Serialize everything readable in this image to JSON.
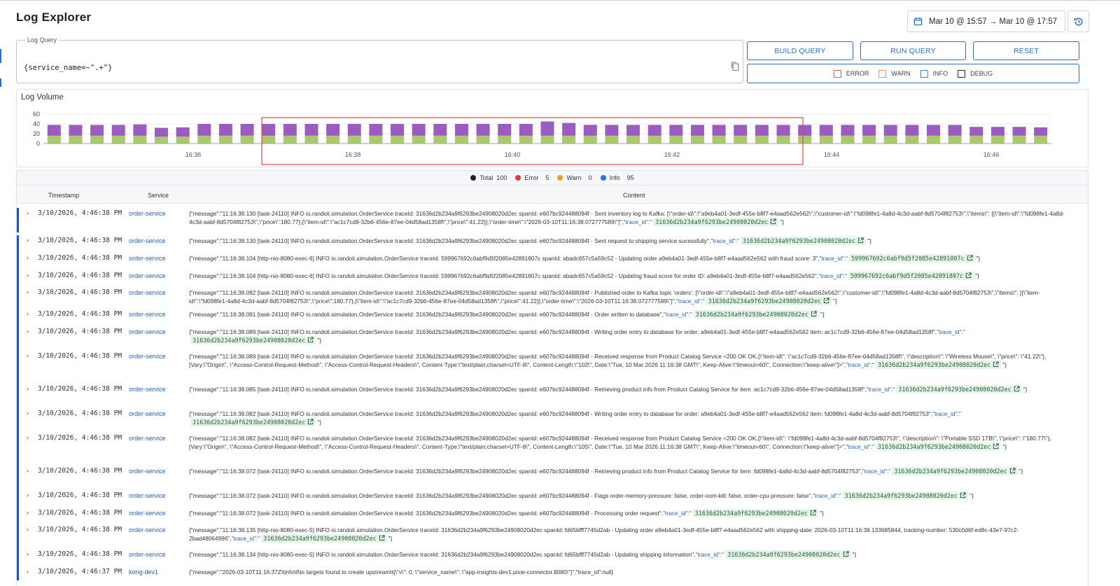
{
  "page": {
    "title": "Log Explorer"
  },
  "date_range": {
    "label": "Mar 10 @ 15:57 → Mar 10 @ 17:57"
  },
  "query": {
    "legend": "Log Query",
    "value": "{service_name=~\".+\"}"
  },
  "buttons": {
    "build": "BUILD QUERY",
    "run": "RUN QUERY",
    "reset": "RESET"
  },
  "levels": [
    {
      "label": "ERROR",
      "color": "#e05a5a"
    },
    {
      "label": "WARN",
      "color": "#e8954a"
    },
    {
      "label": "INFO",
      "color": "#3b7bd6"
    },
    {
      "label": "DEBUG",
      "color": "#222222"
    }
  ],
  "volume": {
    "title": "Log Volume"
  },
  "chart_data": {
    "type": "bar",
    "stacked": true,
    "yticks": [
      "60",
      "40",
      "20",
      "0"
    ],
    "ylim": [
      0,
      60
    ],
    "xticks": [
      "16:36",
      "16:38",
      "16:40",
      "16:42",
      "16:44",
      "16:46"
    ],
    "selection": {
      "from": "16:37:30",
      "to": "16:43:00"
    },
    "series": [
      {
        "color": "#a9c96b",
        "values": [
          16,
          16,
          16,
          16,
          16,
          14,
          14,
          16,
          16,
          16,
          16,
          16,
          16,
          16,
          16,
          16,
          16,
          16,
          16,
          16,
          16,
          16,
          16,
          16,
          16,
          16,
          16,
          16,
          16,
          16,
          16,
          16,
          16,
          16,
          16,
          16,
          16,
          16,
          16,
          16,
          16,
          16,
          16,
          16,
          16,
          16,
          16
        ]
      },
      {
        "color": "#9a5cc0",
        "values": [
          22,
          22,
          22,
          22,
          23,
          18,
          19,
          24,
          24,
          24,
          24,
          24,
          24,
          24,
          24,
          24,
          24,
          24,
          24,
          24,
          24,
          24,
          24,
          29,
          26,
          22,
          22,
          22,
          22,
          22,
          22,
          22,
          22,
          22,
          22,
          22,
          22,
          22,
          22,
          22,
          22,
          22,
          22,
          18,
          18,
          18,
          17
        ]
      }
    ]
  },
  "summary": {
    "total_label": "Total",
    "total": "100",
    "error_label": "Error",
    "error": "5",
    "warn_label": "Warn",
    "warn": "0",
    "info_label": "Info",
    "info": "95"
  },
  "table": {
    "headers": {
      "timestamp": "Timestamp",
      "service": "Service",
      "content": "Content"
    },
    "rows": [
      {
        "ts": "3/10/2026, 4:46:38 PM",
        "service": "order-service",
        "msg": "{\"message\":\"11:16:38.130 [task-24110] INFO  io.randoli.simulation.OrderService traceId: 31636d2b234a9f6293be24908020d2ec spanId: e607bc924488094f - Sent inventory log to Kafka: [\\\"order-id\\\":\\\"a9eb4a01-3edf-455e-b8f7-e4aad562e562\\\",\\\"customer-id\\\":\\\"fd098fe1-4a8d-4c3d-aabf-8d5704f82753\\\",\\\"items\\\": [{\\\"item-id\\\":\\\"fd098fe1-4a8d-4c3d-aabf-8d5704f82753\\\",\\\"price\\\":180.77},{\\\"item-id\\\":\\\"ac1c7cd9-32b6-456e-87ee-04d58ad1358f\\\",\\\"price\\\":41.22}],\\\"order-time\\\":\\\"2026-03-10T11:16:38.072777589\\\"]\",",
        "trace_key": "\"trace_id\":\"",
        "trace": "31636d2b234a9f6293be24908020d2ec",
        "tail": "\"}"
      },
      {
        "ts": "3/10/2026, 4:46:38 PM",
        "service": "order-service",
        "msg": "{\"message\":\"11:16:38.130 [task-24110] INFO  io.randoli.simulation.OrderService traceId: 31636d2b234a9f6293be24908020d2ec spanId: e607bc924488094f - Sent request to shipping service sucessfully\",",
        "trace_key": "\"trace_id\":\"",
        "trace": "31636d2b234a9f6293be24908020d2ec",
        "tail": "\"}"
      },
      {
        "ts": "3/10/2026, 4:46:38 PM",
        "service": "order-service",
        "msg": "{\"message\":\"11:16:38.104 [http-nio-8080-exec-6] INFO  io.randoli.simulation.OrderService traceId: 599967692c6abf9d5f2085e42891807c spanId: abadc657c5a59c52 - Updating order a9eb4a01-3edf-455e-b8f7-e4aad562e562 with fraud score: 3\",",
        "trace_key": "\"trace_id\":\"",
        "trace": "599967692c6abf9d5f2085e42891807c",
        "tail": "\"}"
      },
      {
        "ts": "3/10/2026, 4:46:38 PM",
        "service": "order-service",
        "msg": "{\"message\":\"11:16:38.104 [http-nio-8080-exec-6] INFO  io.randoli.simulation.OrderService traceId: 599967692c6abf9d5f2085e42891807c spanId: abadc657c5a59c52 - Updating fraud score for order ID: a9eb4a01-3edf-455e-b8f7-e4aad562e562\",",
        "trace_key": "\"trace_id\":\"",
        "trace": "599967692c6abf9d5f2085e42891807c",
        "tail": "\"}"
      },
      {
        "ts": "3/10/2026, 4:46:38 PM",
        "service": "order-service",
        "msg": "{\"message\":\"11:16:38.092 [task-24110] INFO  io.randoli.simulation.OrderService traceId: 31636d2b234a9f6293be24908020d2ec spanId: e607bc924488094f - Published order to Kafka topic 'orders': [\\\"order-id\\\":\\\"a9eb4a01-3edf-455e-b8f7-e4aad562e562\\\",\\\"customer-id\\\":\\\"fd098fe1-4a8d-4c3d-aabf-8d5704f82753\\\",\\\"items\\\": [{\\\"item-id\\\":\\\"fd098fe1-4a8d-4c3d-aabf-8d5704f82753\\\",\\\"price\\\":180.77},{\\\"item-id\\\":\\\"ac1c7cd9-32b6-456e-87ee-04d58ad1358f\\\",\\\"price\\\":41.22}],\\\"order-time\\\":\\\"2026-03-10T11:16:38.072777589\\\"]\",",
        "trace_key": "\"trace_id\":\"",
        "trace": "31636d2b234a9f6293be24908020d2ec",
        "tail": "\"}"
      },
      {
        "ts": "3/10/2026, 4:46:38 PM",
        "service": "order-service",
        "msg": "{\"message\":\"11:16:38.091 [task-24110] INFO  io.randoli.simulation.OrderService traceId: 31636d2b234a9f6293be24908020d2ec spanId: e607bc924488094f - Order written to database\",",
        "trace_key": "\"trace_id\":\"",
        "trace": "31636d2b234a9f6293be24908020d2ec",
        "tail": "\"}"
      },
      {
        "ts": "3/10/2026, 4:46:38 PM",
        "service": "order-service",
        "msg": "{\"message\":\"11:16:38.089 [task-24110] INFO  io.randoli.simulation.OrderService traceId: 31636d2b234a9f6293be24908020d2ec spanId: e607bc924488094f - Writing order entry to database for order: a9eb4a01-3edf-455e-b8f7-e4aad562e562 item: ac1c7cd9-32b6-456e-87ee-04d58ad1358f\",",
        "trace_key": "\"trace_id\":\"",
        "trace": "31636d2b234a9f6293be24908020d2ec",
        "tail": "\"}"
      },
      {
        "ts": "3/10/2026, 4:46:38 PM",
        "service": "order-service",
        "msg": "{\"message\":\"11:16:38.089 [task-24110] INFO  io.randoli.simulation.OrderService traceId: 31636d2b234a9f6293be24908020d2ec spanId: e607bc924488094f - Received response from Product Catalog Service <200 OK OK,{\\\"item-id\\\": \\\"ac1c7cd9-32b6-456e-87ee-04d58ad1358f\\\", \\\"description\\\": \\\"Wireless Mouse\\\", \\\"price\\\": \\\"41.22\\\"},[Vary:\\\"Origin\\\", \\\"Access-Control-Request-Method\\\", \\\"Access-Control-Request-Headers\\\", Content-Type:\\\"text/plain;charset=UTF-8\\\", Content-Length:\\\"102\\\", Date:\\\"Tue, 10 Mar 2026 11:16:38 GMT\\\", Keep-Alive:\\\"timeout=60\\\", Connection:\\\"keep-alive\\\"]>\",",
        "trace_key": "\"trace_id\":\"",
        "trace": "31636d2b234a9f6293be24908020d2ec",
        "tail": "\"}"
      },
      {
        "ts": "3/10/2026, 4:46:38 PM",
        "service": "order-service",
        "msg": "{\"message\":\"11:16:38.085 [task-24110] INFO  io.randoli.simulation.OrderService traceId: 31636d2b234a9f6293be24908020d2ec spanId: e607bc924488094f - Retrieving product info from Product Catalog Service for item :ac1c7cd9-32b6-456e-87ee-04d58ad1358f\",",
        "trace_key": "\"trace_id\":\"",
        "trace": "31636d2b234a9f6293be24908020d2ec",
        "tail": "\"}"
      },
      {
        "ts": "3/10/2026, 4:46:38 PM",
        "service": "order-service",
        "msg": "{\"message\":\"11:16:38.082 [task-24110] INFO  io.randoli.simulation.OrderService traceId: 31636d2b234a9f6293be24908020d2ec spanId: e607bc924488094f - Writing order entry to database for order: a9eb4a01-3edf-455e-b8f7-e4aad562e562 item: fd098fe1-4a8d-4c3d-aabf-8d5704f82753\",",
        "trace_key": "\"trace_id\":\"",
        "trace": "31636d2b234a9f6293be24908020d2ec",
        "tail": "\"}"
      },
      {
        "ts": "3/10/2026, 4:46:38 PM",
        "service": "order-service",
        "msg": "{\"message\":\"11:16:38.082 [task-24110] INFO  io.randoli.simulation.OrderService traceId: 31636d2b234a9f6293be24908020d2ec spanId: e607bc924488094f - Received response from Product Catalog Service <200 OK OK,{\\\"item-id\\\": \\\"fd098fe1-4a8d-4c3d-aabf-8d5704f82753\\\", \\\"description\\\": \\\"Portable SSD 1TB\\\", \\\"price\\\": \\\"180.77\\\"},[Vary:\\\"Origin\\\", \\\"Access-Control-Request-Method\\\", \\\"Access-Control-Request-Headers\\\", Content-Type:\\\"text/plain;charset=UTF-8\\\", Content-Length:\\\"105\\\", Date:\\\"Tue, 10 Mar 2026 11:16:38 GMT\\\", Keep-Alive:\\\"timeout=60\\\", Connection:\\\"keep-alive\\\"]>\",",
        "trace_key": "\"trace_id\":\"",
        "trace": "31636d2b234a9f6293be24908020d2ec",
        "tail": "\"}"
      },
      {
        "ts": "3/10/2026, 4:46:38 PM",
        "service": "order-service",
        "msg": "{\"message\":\"11:16:38.072 [task-24110] INFO  io.randoli.simulation.OrderService traceId: 31636d2b234a9f6293be24908020d2ec spanId: e607bc924488094f - Retrieving product info from Product Catalog Service for item :fd098fe1-4a8d-4c3d-aabf-8d5704f82753\",",
        "trace_key": "\"trace_id\":\"",
        "trace": "31636d2b234a9f6293be24908020d2ec",
        "tail": "\"}"
      },
      {
        "ts": "3/10/2026, 4:46:38 PM",
        "service": "order-service",
        "msg": "{\"message\":\"11:16:38.072 [task-24110] INFO  io.randoli.simulation.OrderService traceId: 31636d2b234a9f6293be24908020d2ec spanId: e607bc924488094f - Flags order-memory-pressure: false, order-oom-kill: false, order-cpu-pressure: false\",",
        "trace_key": "\"trace_id\":\"",
        "trace": "31636d2b234a9f6293be24908020d2ec",
        "tail": "\"}"
      },
      {
        "ts": "3/10/2026, 4:46:38 PM",
        "service": "order-service",
        "msg": "{\"message\":\"11:16:38.072 [task-24110] INFO  io.randoli.simulation.OrderService traceId: 31636d2b234a9f6293be24908020d2ec spanId: e607bc924488094f - Processing order request\",",
        "trace_key": "\"trace_id\":\"",
        "trace": "31636d2b234a9f6293be24908020d2ec",
        "tail": "\"}"
      },
      {
        "ts": "3/10/2026, 4:46:38 PM",
        "service": "order-service",
        "msg": "{\"message\":\"11:16:38.135 [http-nio-8080-exec-5] INFO  io.randoli.simulation.OrderService traceId: 31636d2b234a9f6293be24908020d2ec spanId: fd65bfff7745d2ab - Updating order a9eb4a01-3edf-455e-b8f7-e4aad562e562 with shipping-date: 2026-03-10T11:16:38.133685844, tracking-number: 530c0d6f-ed8c-43e7-97c2-2bad48064996\",",
        "trace_key": "\"trace_id\":\"",
        "trace": "31636d2b234a9f6293be24908020d2ec",
        "tail": "\"}"
      },
      {
        "ts": "3/10/2026, 4:46:38 PM",
        "service": "order-service",
        "msg": "{\"message\":\"11:16:38.134 [http-nio-8080-exec-5] INFO  io.randoli.simulation.OrderService traceId: 31636d2b234a9f6293be24908020d2ec spanId: fd65bfff7745d2ab - Updating shipping information\",",
        "trace_key": "\"trace_id\":\"",
        "trace": "31636d2b234a9f6293be24908020d2ec",
        "tail": "\"}"
      },
      {
        "ts": "3/10/2026, 4:46:37 PM",
        "service": "kong-dev1",
        "msg": "{\"message\":\"2026-03-10T11:16:37Z\\tinfo\\tNo targets found to create upstream\\t{\\\"v\\\": 0, \\\"service_name\\\": \\\"app-insights-dev1.pixie-connector.8080\\\"}\",\"trace_id\":null}",
        "trace_key": "",
        "trace": "",
        "tail": ""
      }
    ]
  }
}
